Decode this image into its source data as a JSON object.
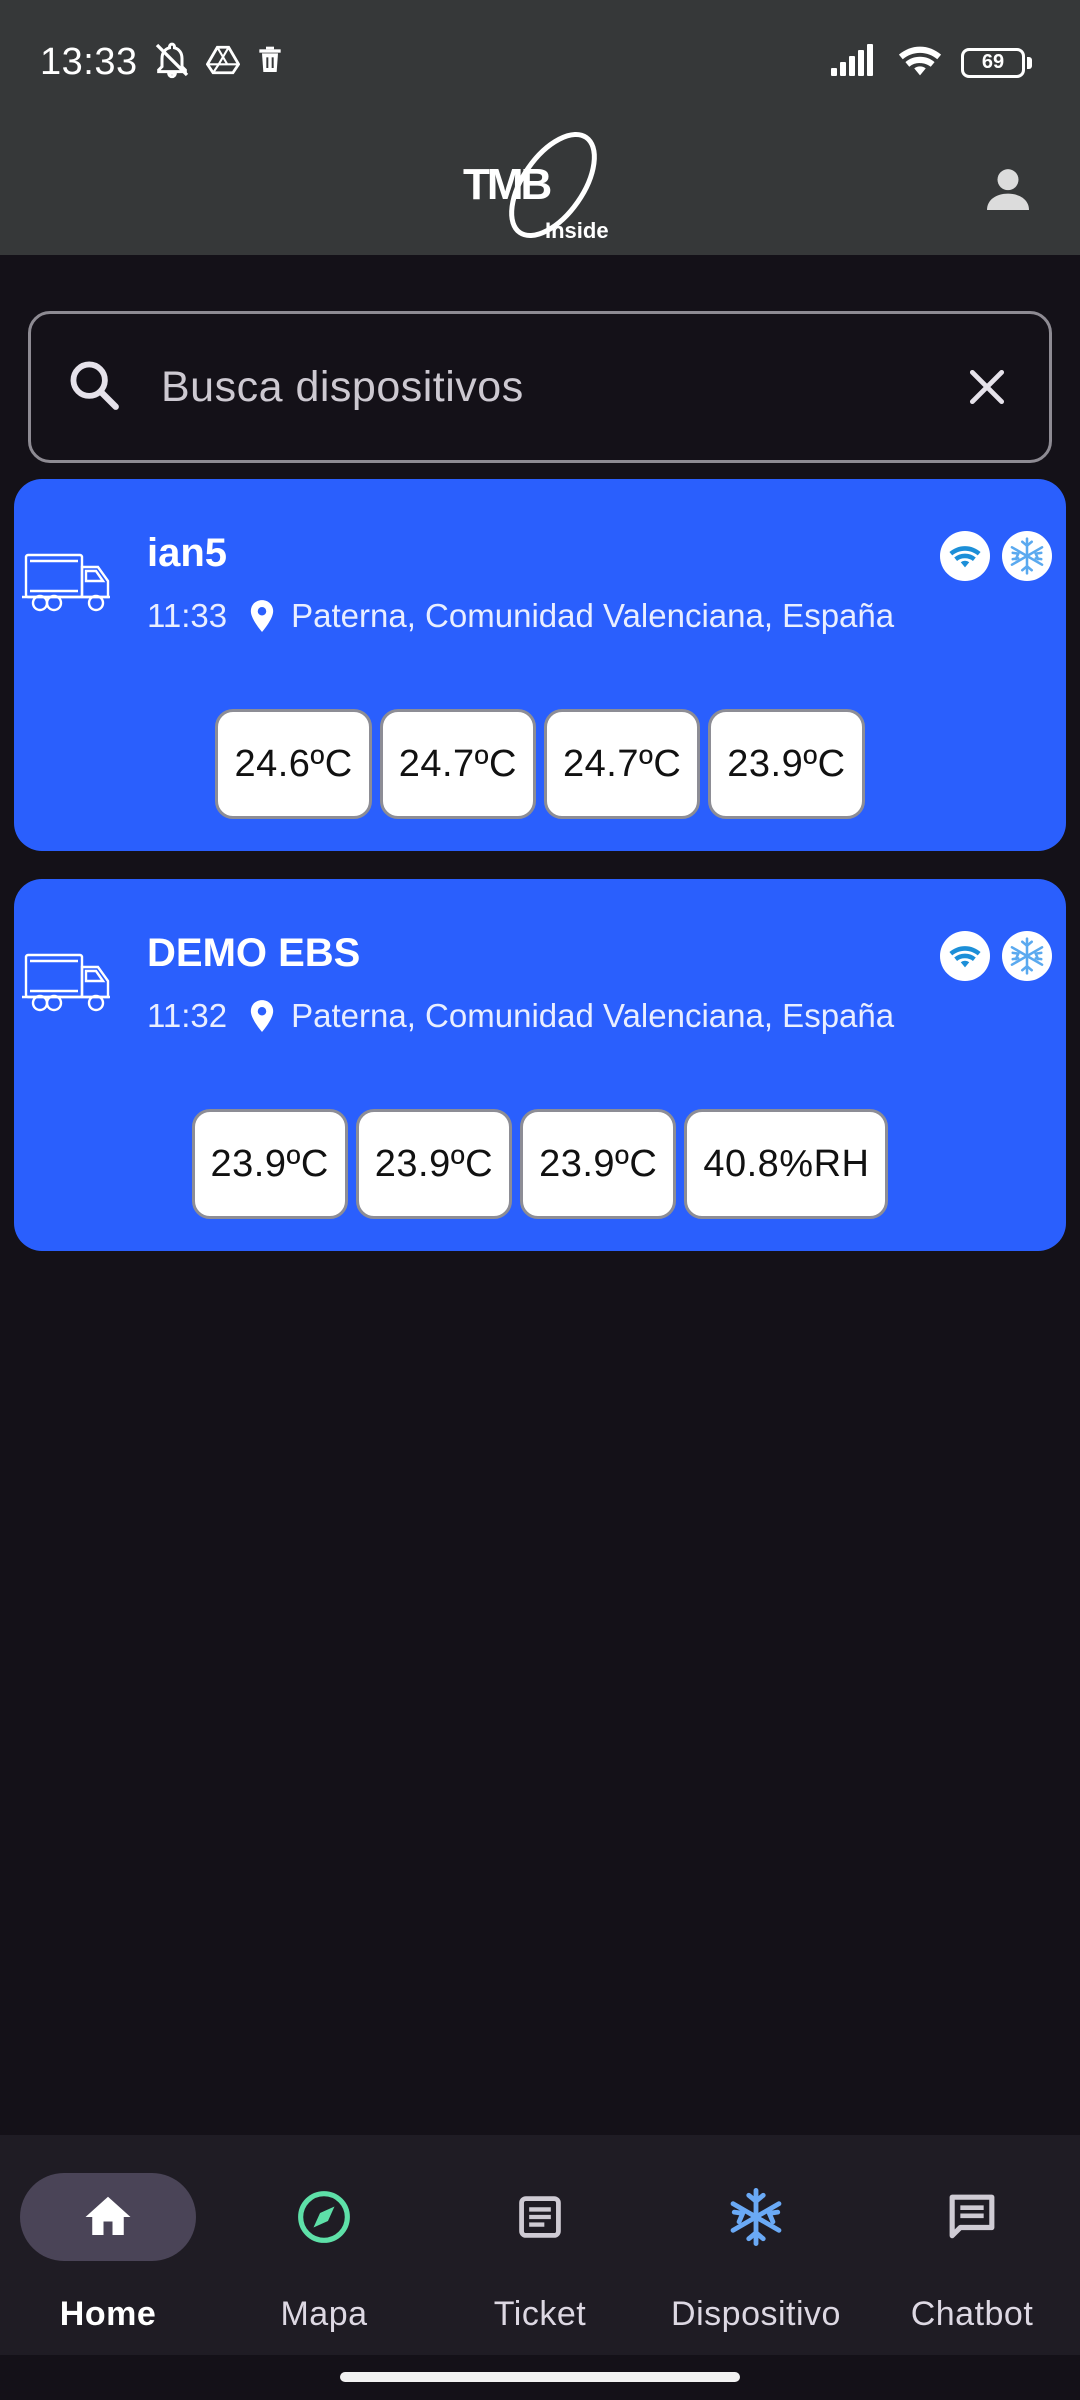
{
  "status_bar": {
    "time": "13:33",
    "battery": "69",
    "icons": [
      "bell-off-icon",
      "drive-icon",
      "trash-icon",
      "signal-icon",
      "wifi-icon",
      "battery-icon"
    ]
  },
  "app_bar": {
    "logo_text": "TMB",
    "logo_sub": "Inside",
    "profile_icon": "person-icon"
  },
  "search": {
    "placeholder": "Busca dispositivos",
    "value": ""
  },
  "devices": [
    {
      "name": "ian5",
      "time": "11:33",
      "location": "Paterna, Comunidad Valenciana, España",
      "badges": [
        "wifi-icon",
        "snowflake-icon"
      ],
      "readings": [
        "24.6ºC",
        "24.7ºC",
        "24.7ºC",
        "23.9ºC"
      ]
    },
    {
      "name": "DEMO EBS",
      "time": "11:32",
      "location": "Paterna, Comunidad Valenciana, España",
      "badges": [
        "wifi-icon",
        "snowflake-icon"
      ],
      "readings": [
        "23.9ºC",
        "23.9ºC",
        "23.9ºC",
        "40.8%RH"
      ]
    }
  ],
  "bottom_nav": {
    "active": "Home",
    "items": [
      {
        "label": "Home",
        "icon": "home-icon",
        "color": "#ffffff"
      },
      {
        "label": "Mapa",
        "icon": "compass-icon",
        "color": "#5ee0a8"
      },
      {
        "label": "Ticket",
        "icon": "document-icon",
        "color": "#cfcbd4"
      },
      {
        "label": "Dispositivo",
        "icon": "snowflake-icon",
        "color": "#6aa9f5"
      },
      {
        "label": "Chatbot",
        "icon": "chat-icon",
        "color": "#cfcbd4"
      }
    ]
  },
  "colors": {
    "card": "#2a5ffd",
    "background": "#141118",
    "app_bar": "#363839"
  }
}
